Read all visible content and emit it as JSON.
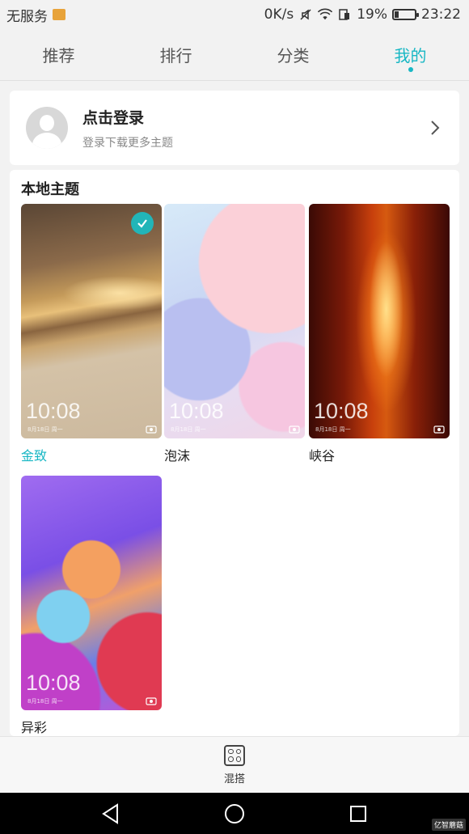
{
  "status_bar": {
    "carrier": "无服务",
    "speed": "0K/s",
    "battery": "19%",
    "battery_level": 0.19,
    "time": "23:22"
  },
  "tabs": [
    {
      "label": "推荐",
      "active": false
    },
    {
      "label": "排行",
      "active": false
    },
    {
      "label": "分类",
      "active": false
    },
    {
      "label": "我的",
      "active": true
    }
  ],
  "login": {
    "title": "点击登录",
    "subtitle": "登录下载更多主题"
  },
  "local_themes": {
    "title": "本地主题",
    "items": [
      {
        "name": "金致",
        "time": "10:08",
        "date": "8月18日 周一",
        "selected": true
      },
      {
        "name": "泡沫",
        "time": "10:08",
        "date": "8月18日 周一",
        "selected": false
      },
      {
        "name": "峡谷",
        "time": "10:08",
        "date": "8月18日 周一",
        "selected": false
      },
      {
        "name": "异彩",
        "time": "10:08",
        "date": "8月18日 周一",
        "selected": false
      }
    ]
  },
  "bottom": {
    "mix_label": "混搭"
  },
  "watermark": "亿智蘑菇",
  "colors": {
    "accent": "#18b7c4",
    "check": "#22b5b8"
  }
}
